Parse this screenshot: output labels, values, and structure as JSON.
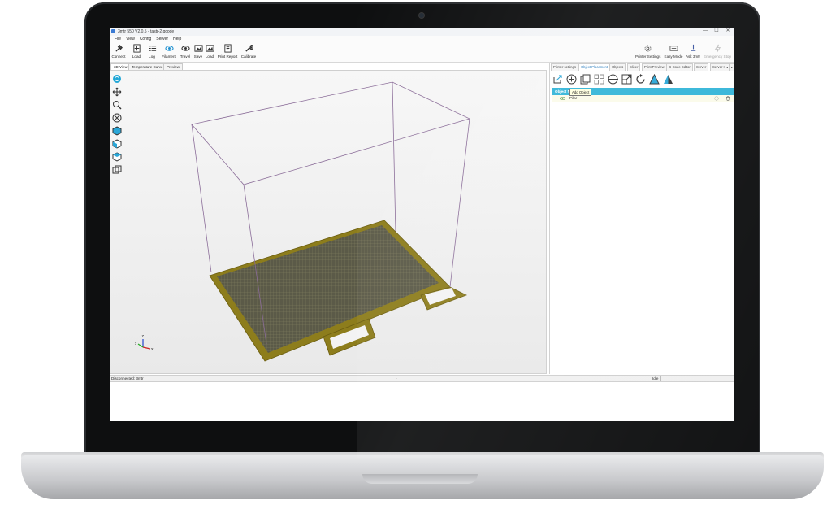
{
  "window": {
    "title": "3mtr 550 V2.0.5 - tastr-2.gcode",
    "min_symbol": "—",
    "max_symbol": "☐",
    "close_symbol": "✕"
  },
  "menu": [
    "File",
    "View",
    "Config",
    "Server",
    "Help"
  ],
  "toolbar": {
    "left": [
      {
        "label": "Connect",
        "icon": "connect-plug-icon"
      },
      {
        "label": "Load",
        "icon": "load-file-icon"
      },
      {
        "label": "Log",
        "icon": "log-list-icon"
      },
      {
        "label": "Filament",
        "icon": "filament-eye-icon"
      },
      {
        "label": "Travel",
        "icon": "travel-eye-icon"
      },
      {
        "label": "Save",
        "icon": "save-image-icon"
      },
      {
        "label": "Load",
        "icon": "load-image-icon"
      },
      {
        "label": "Print Report",
        "icon": "print-report-icon"
      },
      {
        "label": "Calibrate",
        "icon": "wrench-icon"
      }
    ],
    "right": [
      {
        "label": "Printer Settings",
        "icon": "gear-icon"
      },
      {
        "label": "Easy Mode",
        "icon": "keyboard-icon"
      },
      {
        "label": "Ask 3mtr",
        "icon": "question-icon"
      },
      {
        "label": "Emergency Stop",
        "icon": "lightning-icon"
      }
    ]
  },
  "view_tabs": [
    "3D View",
    "Temperature Curve",
    "Preview"
  ],
  "side_tools": [
    "rotate-view-icon",
    "move-view-icon",
    "zoom-view-icon",
    "reset-view-icon",
    "iso-view-icon",
    "front-view-icon",
    "top-view-icon",
    "side-view-icon"
  ],
  "axes": {
    "x": "x",
    "y": "y",
    "z": "z"
  },
  "right_tabs": [
    "Printer settings",
    "Object Placement",
    "Objects",
    "Slicer",
    "Print Preview",
    "G-Code Editor",
    "Server",
    "Server I"
  ],
  "placement_tools": [
    "export-icon",
    "add-object-icon",
    "copy-icon",
    "autoposition-icon",
    "center-icon",
    "scale-icon",
    "rotate-icon",
    "mirror-icon",
    "cut-icon"
  ],
  "tooltip": "Add Object",
  "object_list": {
    "header": "Object Name",
    "rows": [
      {
        "name": "Pilar"
      }
    ]
  },
  "status": {
    "left": "Disconnected: 3mtr",
    "middle": "-",
    "right": "Idle"
  },
  "colors": {
    "accent": "#33b5d8",
    "bed": "#8d7d1c",
    "frame": "#8a6c98"
  }
}
